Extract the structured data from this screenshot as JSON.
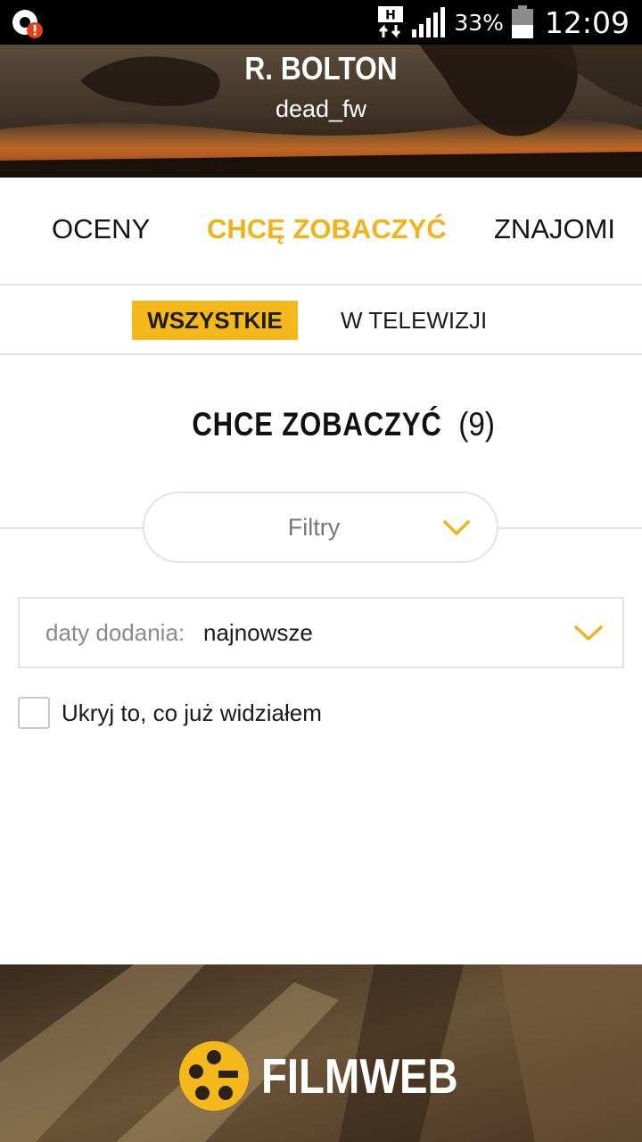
{
  "status_bar": {
    "network_type": "H",
    "battery_percent": "33%",
    "time": "12:09",
    "icons": [
      "notification-alert-icon",
      "network-data-icon",
      "signal-icon",
      "battery-icon"
    ]
  },
  "profile": {
    "name": "R. BOLTON",
    "login": "dead_fw"
  },
  "main_tabs": [
    {
      "label": "OCENY",
      "active": false
    },
    {
      "label": "CHCĘ ZOBACZYĆ",
      "active": true
    },
    {
      "label": "ZNAJOMI",
      "active": false
    }
  ],
  "sub_tabs": [
    {
      "label": "WSZYSTKIE",
      "active": true
    },
    {
      "label": "W TELEWIZJI",
      "active": false
    }
  ],
  "section": {
    "title": "CHCE ZOBACZYĆ",
    "count": "(9)"
  },
  "filters": {
    "label": "Filtry",
    "icon": "chevron-down-icon"
  },
  "sort": {
    "label": "daty dodania:",
    "value": "najnowsze",
    "icon": "chevron-down-icon"
  },
  "hide_seen": {
    "label": "Ukryj to, co już widziałem",
    "checked": false
  },
  "footer": {
    "brand": "FILMWEB",
    "icon": "filmweb-logo-icon"
  },
  "colors": {
    "accent": "#f4b81a",
    "active_tab": "#f0b31b",
    "text": "#141414",
    "border": "#e3e3e3"
  }
}
